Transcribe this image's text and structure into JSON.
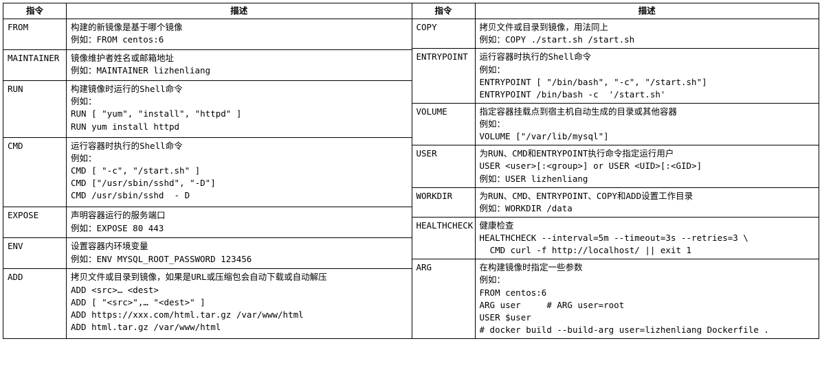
{
  "headers": {
    "cmd": "指令",
    "desc": "描述"
  },
  "left_rows": [
    {
      "cmd": "FROM",
      "desc": "构建的新镜像是基于哪个镜像\n例如：FROM centos:6"
    },
    {
      "cmd": "MAINTAINER",
      "desc": "镜像维护者姓名或邮箱地址\n例如：MAINTAINER lizhenliang"
    },
    {
      "cmd": "RUN",
      "desc": "构建镜像时运行的Shell命令\n例如：\nRUN [ \"yum\", \"install\", \"httpd\" ]\nRUN yum install httpd"
    },
    {
      "cmd": "CMD",
      "desc": "运行容器时执行的Shell命令\n例如：\nCMD [ \"-c\", \"/start.sh\" ]\nCMD [\"/usr/sbin/sshd\", \"-D\"]\nCMD /usr/sbin/sshd  - D"
    },
    {
      "cmd": "EXPOSE",
      "desc": "声明容器运行的服务端口\n例如：EXPOSE 80 443"
    },
    {
      "cmd": "ENV",
      "desc": "设置容器内环境变量\n例如：ENV MYSQL_ROOT_PASSWORD 123456"
    },
    {
      "cmd": "ADD",
      "desc": "拷贝文件或目录到镜像，如果是URL或压缩包会自动下载或自动解压\nADD <src>… <dest>\nADD [ \"<src>\",… \"<dest>\" ]\nADD https://xxx.com/html.tar.gz /var/www/html\nADD html.tar.gz /var/www/html"
    }
  ],
  "right_rows": [
    {
      "cmd": "COPY",
      "desc": "拷贝文件或目录到镜像，用法同上\n例如：COPY ./start.sh /start.sh"
    },
    {
      "cmd": "ENTRYPOINT",
      "desc": "运行容器时执行的Shell命令\n例如：\nENTRYPOINT [ \"/bin/bash\", \"-c\", \"/start.sh\"]\nENTRYPOINT /bin/bash -c  '/start.sh'"
    },
    {
      "cmd": "VOLUME",
      "desc": "指定容器挂载点到宿主机自动生成的目录或其他容器\n例如：\nVOLUME [\"/var/lib/mysql\"]"
    },
    {
      "cmd": "USER",
      "desc": "为RUN、CMD和ENTRYPOINT执行命令指定运行用户\nUSER <user>[:<group>] or USER <UID>[:<GID>]\n例如：USER lizhenliang"
    },
    {
      "cmd": "WORKDIR",
      "desc": "为RUN、CMD、ENTRYPOINT、COPY和ADD设置工作目录\n例如：WORKDIR /data"
    },
    {
      "cmd": "HEALTHCHECK",
      "desc": "健康检查\nHEALTHCHECK --interval=5m --timeout=3s --retries=3 \\\n  CMD curl -f http://localhost/ || exit 1"
    },
    {
      "cmd": "ARG",
      "desc": "在构建镜像时指定一些参数\n例如：\nFROM centos:6\nARG user     # ARG user=root\nUSER $user\n# docker build --build-arg user=lizhenliang Dockerfile ."
    }
  ]
}
